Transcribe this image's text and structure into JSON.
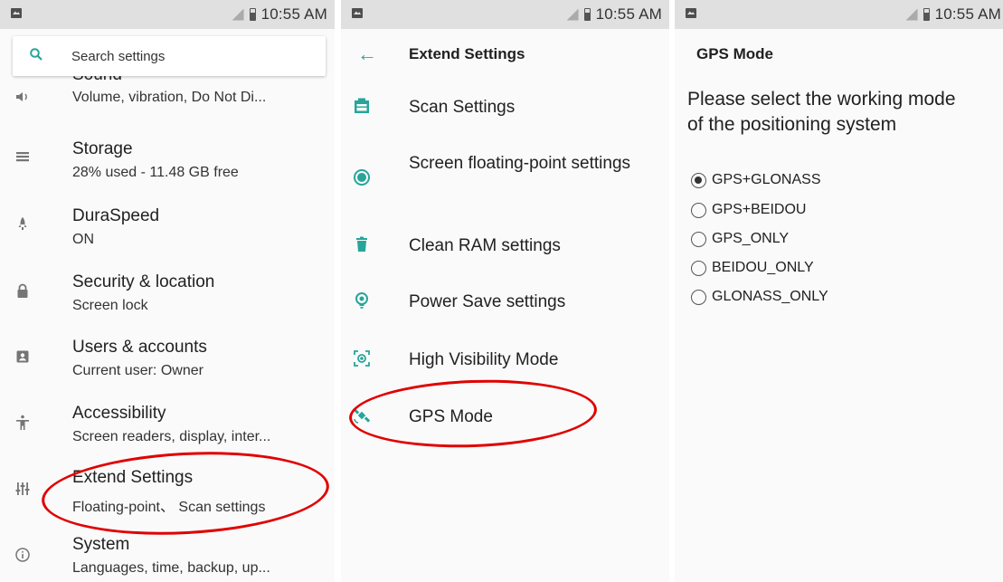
{
  "status_bar": {
    "time": "10:55 AM"
  },
  "panel1": {
    "search": {
      "placeholder": "Search settings"
    },
    "items": [
      {
        "title": "Sound",
        "subtitle": "Volume, vibration, Do Not Di...",
        "icon": "volume-icon"
      },
      {
        "title": "Storage",
        "subtitle": "28% used - 11.48 GB free",
        "icon": "storage-icon"
      },
      {
        "title": "DuraSpeed",
        "subtitle": "ON",
        "icon": "rocket-icon"
      },
      {
        "title": "Security & location",
        "subtitle": "Screen lock",
        "icon": "lock-icon"
      },
      {
        "title": "Users & accounts",
        "subtitle": "Current user: Owner",
        "icon": "account-icon"
      },
      {
        "title": "Accessibility",
        "subtitle": "Screen readers, display, inter...",
        "icon": "accessibility-icon"
      },
      {
        "title": "Extend Settings",
        "subtitle": "Floating-point、 Scan settings",
        "icon": "tune-icon"
      },
      {
        "title": "System",
        "subtitle": "Languages, time, backup, up...",
        "icon": "info-icon"
      }
    ]
  },
  "panel2": {
    "title": "Extend Settings",
    "items": [
      {
        "label": "Scan Settings",
        "icon": "scan-icon"
      },
      {
        "label": "Screen floating-point settings",
        "icon": "floating-point-icon"
      },
      {
        "label": "Clean RAM settings",
        "icon": "trash-icon"
      },
      {
        "label": "Power Save settings",
        "icon": "lightbulb-icon"
      },
      {
        "label": "High Visibility Mode",
        "icon": "visibility-icon"
      },
      {
        "label": "GPS Mode",
        "icon": "satellite-icon"
      }
    ]
  },
  "panel3": {
    "title": "GPS Mode",
    "question": "Please select the working mode of the positioning system",
    "options": [
      {
        "label": "GPS+GLONASS",
        "checked": true
      },
      {
        "label": "GPS+BEIDOU",
        "checked": false
      },
      {
        "label": "GPS_ONLY",
        "checked": false
      },
      {
        "label": "BEIDOU_ONLY",
        "checked": false
      },
      {
        "label": "GLONASS_ONLY",
        "checked": false
      }
    ]
  },
  "colors": {
    "accent": "#26a69a",
    "annotation": "#e00000",
    "status_bar": "#e0e0e0"
  }
}
